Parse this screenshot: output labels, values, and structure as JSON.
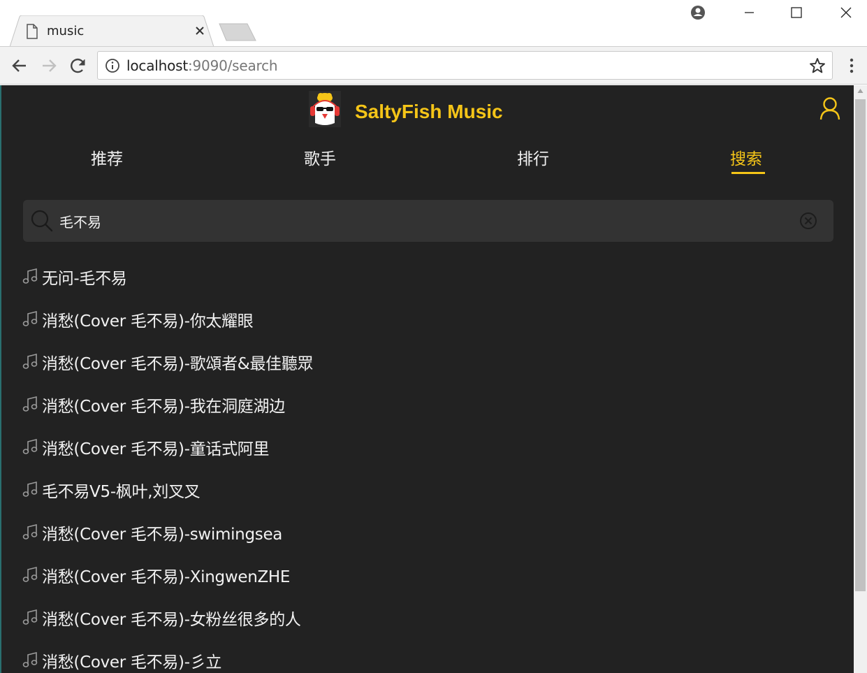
{
  "browser": {
    "tab_title": "music",
    "url_host": "localhost",
    "url_rest": ":9090/search"
  },
  "header": {
    "brand_name": "SaltyFish Music",
    "accent_color": "#f5c518",
    "background_color": "#222222"
  },
  "nav": {
    "tabs": [
      {
        "label": "推荐"
      },
      {
        "label": "歌手"
      },
      {
        "label": "排行"
      },
      {
        "label": "搜索",
        "active": true
      }
    ]
  },
  "search": {
    "value": "毛不易",
    "placeholder": ""
  },
  "results": [
    {
      "title": "无问-毛不易"
    },
    {
      "title": "消愁(Cover 毛不易)-你太耀眼"
    },
    {
      "title": "消愁(Cover 毛不易)-歌頌者&最佳聽眾"
    },
    {
      "title": "消愁(Cover 毛不易)-我在洞庭湖边"
    },
    {
      "title": "消愁(Cover 毛不易)-童话式阿里"
    },
    {
      "title": "毛不易V5-枫叶,刘叉叉"
    },
    {
      "title": "消愁(Cover 毛不易)-swimingsea"
    },
    {
      "title": "消愁(Cover 毛不易)-XingwenZHE"
    },
    {
      "title": "消愁(Cover 毛不易)-女粉丝很多的人"
    },
    {
      "title": "消愁(Cover 毛不易)-彡立"
    }
  ]
}
